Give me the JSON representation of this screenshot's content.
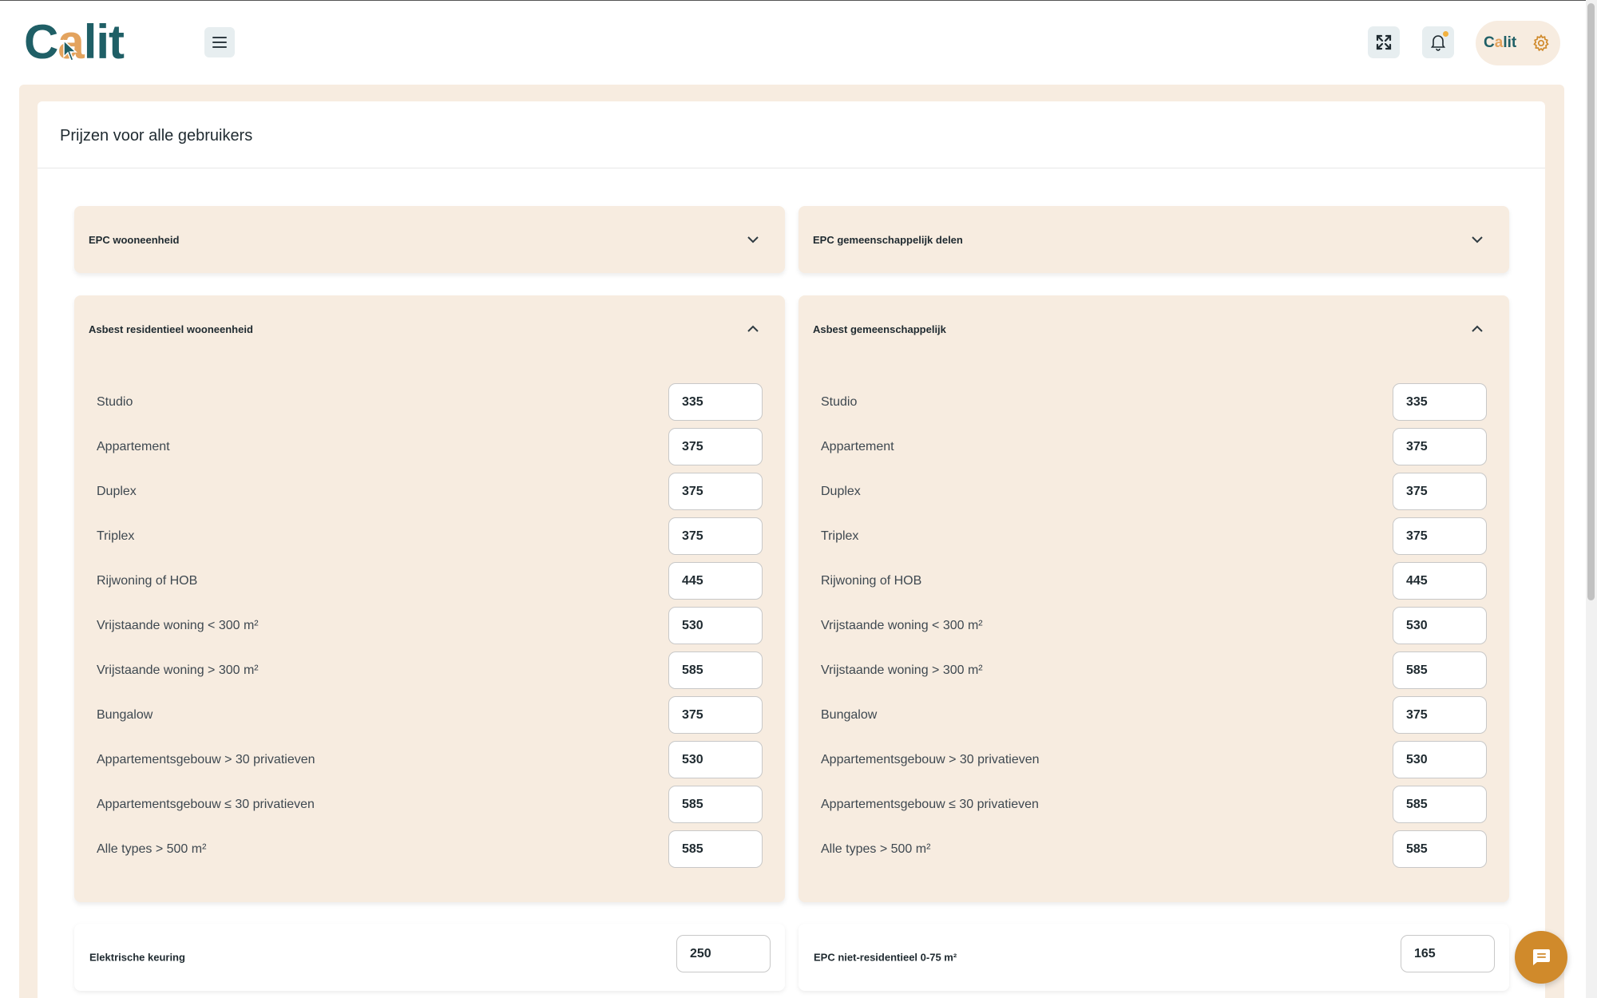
{
  "header": {
    "logo": {
      "c": "C",
      "a": "a",
      "lit": "lit"
    },
    "user_logo": {
      "c": "C",
      "a": "a",
      "lit": "lit"
    }
  },
  "page": {
    "title": "Prijzen voor alle gebruikers"
  },
  "colors": {
    "brand_teal": "#1f5f66",
    "brand_orange": "#e3a35e",
    "panel_bg": "#f7ece0",
    "chat_button": "#d08a2b",
    "notification_dot": "#f2b13f"
  },
  "icons": {
    "menu": "hamburger-icon",
    "fullscreen": "expand-icon",
    "notifications": "bell-icon",
    "settings": "gear-icon",
    "collapsed": "chevron-down-icon",
    "expanded": "chevron-up-icon",
    "chat": "chat-icon"
  },
  "panels": {
    "epc_wooneenheid": {
      "title": "EPC wooneenheid",
      "state": "collapsed"
    },
    "epc_gemeenschappelijk": {
      "title": "EPC gemeenschappelijk delen",
      "state": "collapsed"
    },
    "asbest_residentieel": {
      "title": "Asbest residentieel wooneenheid",
      "state": "expanded",
      "rows": [
        {
          "label": "Studio",
          "value": "335"
        },
        {
          "label": "Appartement",
          "value": "375"
        },
        {
          "label": "Duplex",
          "value": "375"
        },
        {
          "label": "Triplex",
          "value": "375"
        },
        {
          "label": "Rijwoning of HOB",
          "value": "445"
        },
        {
          "label": "Vrijstaande woning < 300 m²",
          "value": "530"
        },
        {
          "label": "Vrijstaande woning > 300 m²",
          "value": "585"
        },
        {
          "label": "Bungalow",
          "value": "375"
        },
        {
          "label": "Appartementsgebouw > 30 privatieven",
          "value": "530"
        },
        {
          "label": "Appartementsgebouw ≤ 30 privatieven",
          "value": "585"
        },
        {
          "label": "Alle types > 500 m²",
          "value": "585"
        }
      ]
    },
    "asbest_gemeenschappelijk": {
      "title": "Asbest gemeenschappelijk",
      "state": "expanded",
      "rows": [
        {
          "label": "Studio",
          "value": "335"
        },
        {
          "label": "Appartement",
          "value": "375"
        },
        {
          "label": "Duplex",
          "value": "375"
        },
        {
          "label": "Triplex",
          "value": "375"
        },
        {
          "label": "Rijwoning of HOB",
          "value": "445"
        },
        {
          "label": "Vrijstaande woning < 300 m²",
          "value": "530"
        },
        {
          "label": "Vrijstaande woning > 300 m²",
          "value": "585"
        },
        {
          "label": "Bungalow",
          "value": "375"
        },
        {
          "label": "Appartementsgebouw > 30 privatieven",
          "value": "530"
        },
        {
          "label": "Appartementsgebouw ≤ 30 privatieven",
          "value": "585"
        },
        {
          "label": "Alle types > 500 m²",
          "value": "585"
        }
      ]
    },
    "elektrische_keuring": {
      "title": "Elektrische keuring",
      "value": "250"
    },
    "epc_niet_residentieel": {
      "title": "EPC niet-residentieel 0-75 m²",
      "value": "165"
    }
  }
}
